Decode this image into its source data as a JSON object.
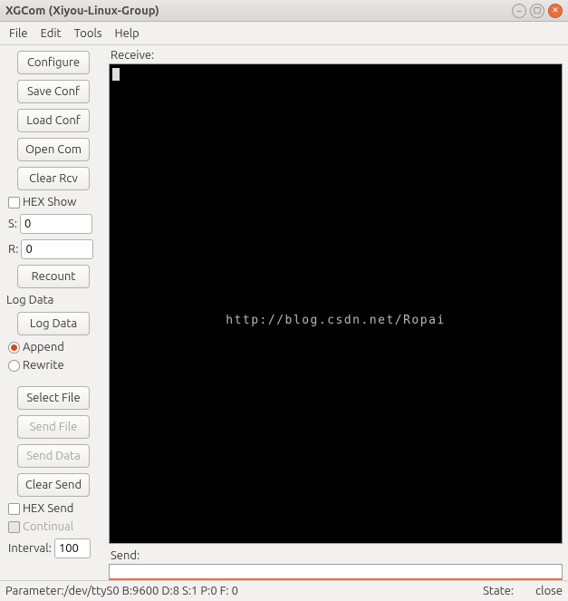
{
  "window": {
    "title": "XGCom (Xiyou-Linux-Group)"
  },
  "menu": {
    "file": "File",
    "edit": "Edit",
    "tools": "Tools",
    "help": "Help"
  },
  "sidebar": {
    "configure": "Configure",
    "saveconf": "Save Conf",
    "loadconf": "Load Conf",
    "opencom": "Open Com",
    "clearrcv": "Clear Rcv",
    "hexshow": "HEX Show",
    "s_label": "S:",
    "s_value": "0",
    "r_label": "R:",
    "r_value": "0",
    "recount": "Recount",
    "logdata_header": "Log Data",
    "logdata_btn": "Log Data",
    "append": "Append",
    "rewrite": "Rewrite",
    "selectfile": "Select File",
    "sendfile": "Send File",
    "senddata": "Send Data",
    "clearsend": "Clear Send",
    "hexsend": "HEX Send",
    "continual": "Continual",
    "interval_label": "Interval:",
    "interval_value": "100"
  },
  "main": {
    "receive_label": "Receive:",
    "watermark": "http://blog.csdn.net/Ropai",
    "send_label": "Send:"
  },
  "status": {
    "param_label": "Parameter: ",
    "param_value": "/dev/ttyS0 B:9600 D:8 S:1 P:0 F: 0",
    "state_label": "State:",
    "state_value": "close"
  }
}
